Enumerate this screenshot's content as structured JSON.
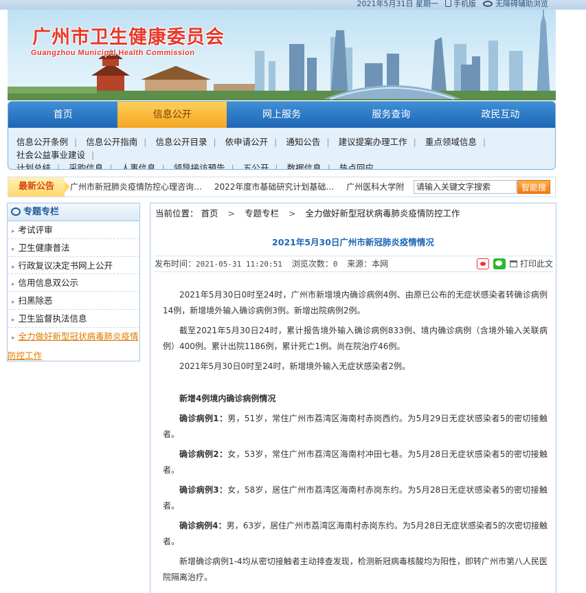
{
  "topbar": {
    "date": "2021年5月31日 星期一",
    "mobile": "手机版",
    "accessibility": "无障碍辅助浏览"
  },
  "banner": {
    "title": "广州市卫生健康委员会",
    "subtitle": "Guangzhou Municipal Health Commission"
  },
  "nav": {
    "main": [
      "首页",
      "信息公开",
      "网上服务",
      "服务查询",
      "政民互动"
    ],
    "active_index": 1,
    "sub": [
      "信息公开条例",
      "信息公开指南",
      "信息公开目录",
      "依申请公开",
      "通知公告",
      "建议提案办理工作",
      "重点领域信息",
      "社会公益事业建设",
      "计划总结",
      "采购信息",
      "人事信息",
      "领导接访预告",
      "五公开",
      "数据信息",
      "热点回应"
    ]
  },
  "ticker": {
    "label": "最新公告",
    "items": [
      "广州市新冠肺炎疫情防控心理咨询…",
      "2022年度市基础研究计划基础…",
      "广州医科大学附"
    ],
    "search_placeholder": "请输入关键文字搜索",
    "search_button": "智能搜索"
  },
  "sidebar": {
    "title": "专题专栏",
    "items": [
      "考试评审",
      "卫生健康普法",
      "行政复议决定书网上公开",
      "信用信息双公示",
      "扫黑除恶",
      "卫生监督执法信息",
      "全力做好新型冠状病毒肺炎疫情防控工作"
    ]
  },
  "breadcrumb": {
    "prefix": "当前位置：",
    "items": [
      "首页",
      "专题专栏",
      "全力做好新型冠状病毒肺炎疫情防控工作"
    ]
  },
  "article": {
    "title": "2021年5月30日广州市新冠肺炎疫情情况",
    "publish_label": "发布时间：",
    "publish_time": "2021-05-31 11:20:51",
    "views_label": "浏览次数：",
    "views": "0",
    "source_label": "来源：",
    "source": "本网",
    "print": "打印此文",
    "paragraphs": [
      "2021年5月30日0时至24时，广州市新增境内确诊病例4例、由原已公布的无症状感染者转确诊病例14例，新增境外输入确诊病例3例。新增出院病例2例。",
      "截至2021年5月30日24时，累计报告境外输入确诊病例833例、境内确诊病例（含境外输入关联病例）400例。累计出院1186例，累计死亡1例。尚在院治疗46例。",
      "2021年5月30日0时至24时，新增境外输入无症状感染者2例。"
    ],
    "section_title": "新增4例境内确诊病例情况",
    "cases": [
      {
        "label": "确诊病例1：",
        "text": "男，51岁，常住广州市荔湾区海南村赤岗西约。为5月29日无症状感染者5的密切接触者。"
      },
      {
        "label": "确诊病例2：",
        "text": "女，53岁，常住广州市荔湾区海南村冲田七巷。为5月28日无症状感染者5的密切接触者。"
      },
      {
        "label": "确诊病例3：",
        "text": "女，58岁，居住广州市荔湾区海南村赤岗东约。为5月28日无症状感染者5的密切接触者。"
      },
      {
        "label": "确诊病例4：",
        "text": "男，63岁，居住广州市荔湾区海南村赤岗东约。为5月28日无症状感染者5的次密切接触者。"
      }
    ],
    "closing": "新增确诊病例1-4均从密切接触者主动排查发现，检测新冠病毒核酸均为阳性，即转广州市第八人民医院隔离治疗。"
  }
}
